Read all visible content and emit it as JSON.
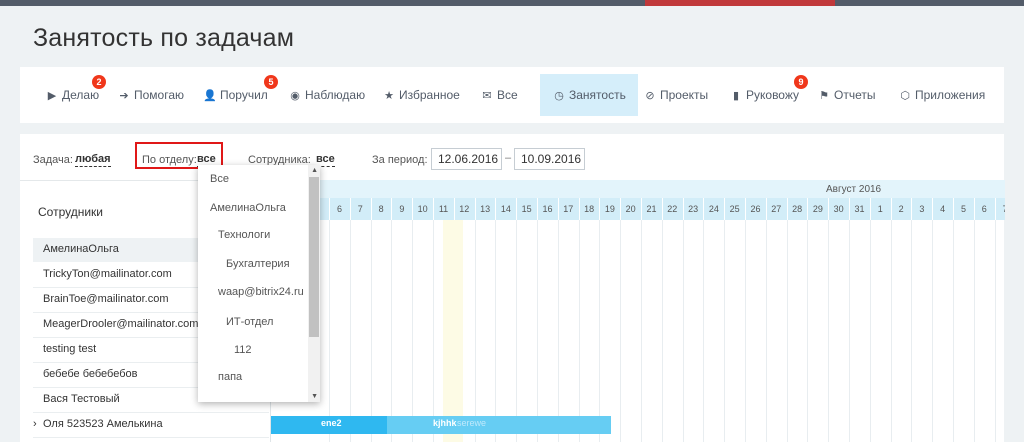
{
  "page_title": "Занятость по задачам",
  "tabs": [
    {
      "label": "Делаю",
      "icon": "play-icon",
      "badge": "2"
    },
    {
      "label": "Помогаю",
      "icon": "arrow-right-icon"
    },
    {
      "label": "Поручил",
      "icon": "user-icon",
      "badge": "5"
    },
    {
      "label": "Наблюдаю",
      "icon": "eye-icon"
    },
    {
      "label": "Избранное",
      "icon": "star-icon"
    },
    {
      "label": "Все",
      "icon": "inbox-icon"
    },
    {
      "label": "Занятость",
      "icon": "clock-icon",
      "active": true
    },
    {
      "label": "Проекты",
      "icon": "compass-icon"
    },
    {
      "label": "Руковожу",
      "icon": "book-icon",
      "badge": "9"
    },
    {
      "label": "Отчеты",
      "icon": "flag-icon"
    },
    {
      "label": "Приложения",
      "icon": "cube-icon"
    }
  ],
  "filters": {
    "task_label": "Задача:",
    "task_value": "любая",
    "dept_label": "По отделу:",
    "dept_value": "все",
    "employee_label": "Сотрудника:",
    "employee_value": "все",
    "period_label": "За период:",
    "date_from": "12.06.2016",
    "date_to": "10.09.2016",
    "dash": "–"
  },
  "employees_header": "Сотрудники",
  "group_name": "АмелинаОльга",
  "people": [
    "TrickyTon@mailinator.com",
    "BrainToe@mailinator.com",
    "MeagerDrooler@mailinator.com",
    "testing test",
    "бебебе бебебебов",
    "Вася Тестовый",
    "Оля 523523 Амелькина"
  ],
  "expand_glyph": "›",
  "calendar": {
    "month_label": "Август 2016",
    "days": [
      "6",
      "7",
      "8",
      "9",
      "10",
      "11",
      "12",
      "13",
      "14",
      "15",
      "16",
      "17",
      "18",
      "19",
      "20",
      "21",
      "22",
      "23",
      "24",
      "25",
      "26",
      "27",
      "28",
      "29",
      "30",
      "31",
      "1",
      "2",
      "3",
      "4",
      "5",
      "6",
      "7",
      "8",
      "9",
      "10"
    ]
  },
  "bars": [
    {
      "label": "ene2"
    },
    {
      "label": "kjhhk"
    },
    {
      "label": "serewe"
    }
  ],
  "dept_dropdown": [
    {
      "label": "Все",
      "indent": 0
    },
    {
      "label": "АмелинаОльга",
      "indent": 0
    },
    {
      "label": "Технологи",
      "indent": 1
    },
    {
      "label": "Бухгалтерия",
      "indent": 2
    },
    {
      "label": "waap@bitrix24.ru",
      "indent": 1
    },
    {
      "label": "ИТ-отдел",
      "indent": 2
    },
    {
      "label": "112",
      "indent": 3
    },
    {
      "label": "папа",
      "indent": 1
    }
  ]
}
